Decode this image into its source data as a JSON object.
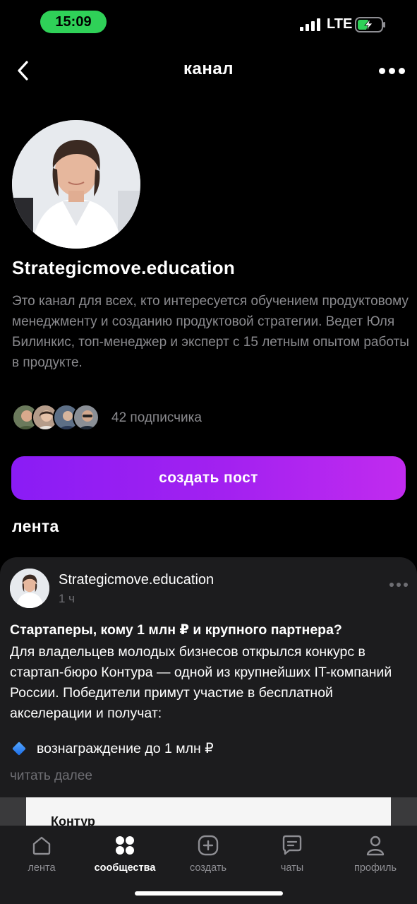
{
  "status_bar": {
    "time": "15:09",
    "network": "LTE"
  },
  "header": {
    "title": "канал"
  },
  "channel": {
    "name": "Strategicmove.education",
    "description": "Это канал для всех, кто интересуется обучением продуктовому менеджменту и созданию продуктовой стратегии. Ведет Юля Билинкис, топ-менеджер и эксперт с 15 летным опытом работы в продукте.",
    "subscribers_label": "42 подписчика"
  },
  "actions": {
    "create_post": "создать пост"
  },
  "feed": {
    "heading": "лента",
    "post": {
      "author": "Strategicmove.education",
      "time": "1 ч",
      "title": "Стартаперы, кому 1 млн ₽ и крупного партнера?",
      "body": "Для владельцев молодых бизнесов открылся конкурс в стартап-бюро Контура — одной из крупнейших IT-компаний России. Победители примут участие в бесплатной акселерации и получат:",
      "bullet": "вознаграждение до 1 млн ₽",
      "read_more": "читать далее",
      "image_label": "Контур"
    }
  },
  "tab_bar": {
    "tabs": [
      {
        "label": "лента",
        "icon": "home-icon"
      },
      {
        "label": "сообщества",
        "icon": "communities-icon"
      },
      {
        "label": "создать",
        "icon": "create-plus-icon"
      },
      {
        "label": "чаты",
        "icon": "chat-icon"
      },
      {
        "label": "профиль",
        "icon": "profile-icon"
      }
    ],
    "active_index": 1
  },
  "colors": {
    "accent_gradient_start": "#8a1cf5",
    "accent_gradient_end": "#c12bef",
    "status_pill": "#2fd158",
    "battery_charge": "#2fd158"
  }
}
